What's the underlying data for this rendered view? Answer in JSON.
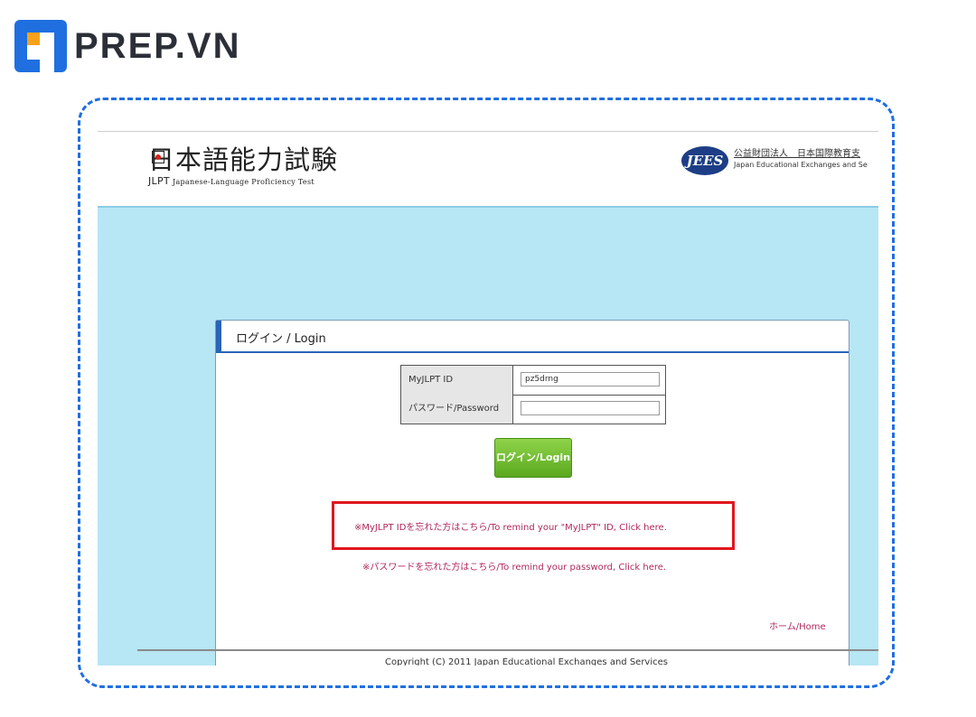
{
  "brand": {
    "name": "PREP.VN",
    "logo_colors": {
      "blue": "#1f6fe0",
      "orange": "#f6a21a"
    }
  },
  "header": {
    "jlpt_title": "日本語能力試験",
    "jlpt_abbr": "JLPT",
    "jlpt_subtitle": "Japanese-Language Proficiency Test",
    "partner_badge": "JEES",
    "partner_name_jp": "公益財団法人　日本国際教育支",
    "partner_name_en": "Japan Educational Exchanges and Se"
  },
  "login": {
    "panel_title": "ログイン / Login",
    "id_label": "MyJLPT ID",
    "id_value": "pz5drng",
    "password_label": "パスワード/Password",
    "password_value": "",
    "login_button": "ログイン/Login",
    "remind_id_link": "※MyJLPT IDを忘れた方はこちら/To remind your \"MyJLPT\" ID, Click here.",
    "remind_password_link": "※パスワードを忘れた方はこちら/To remind your password, Click here.",
    "home_link": "ホーム/Home"
  },
  "footer": {
    "copyright": "Copyright (C) 2011 Japan Educational Exchanges and Services"
  },
  "colors": {
    "frame_dash": "#1f6fe0",
    "highlight_box": "#e0161e",
    "link": "#b0285a",
    "page_bg": "#b7e6f4",
    "button_green": "#6ab82e"
  }
}
